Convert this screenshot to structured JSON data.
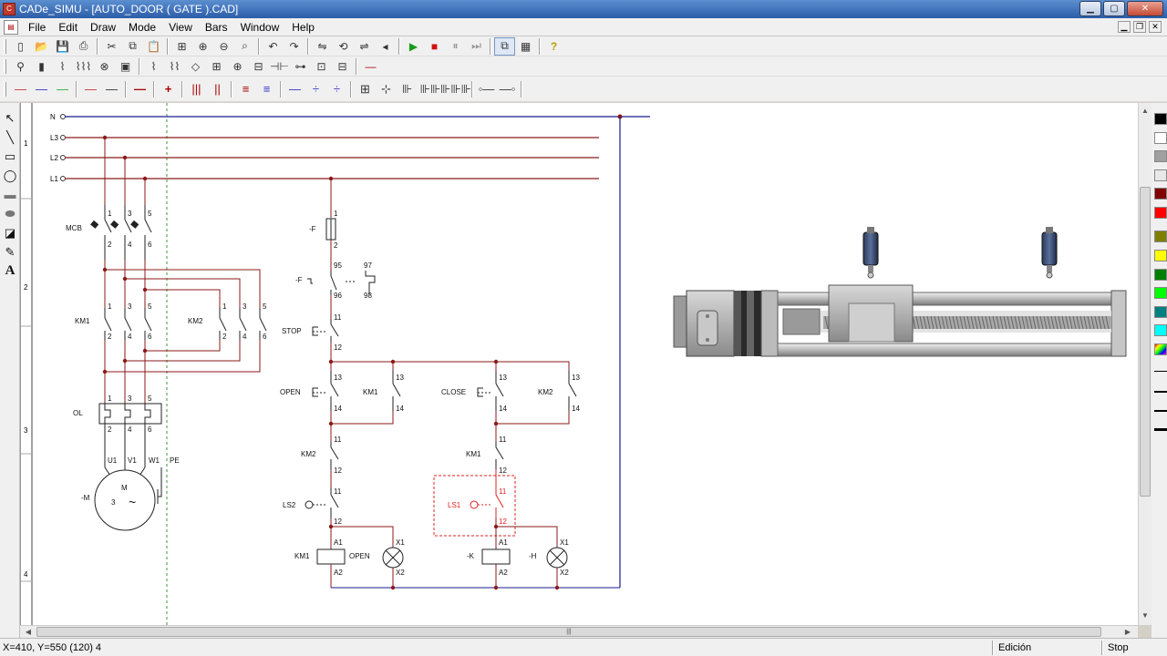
{
  "window": {
    "app_title": "CADe_SIMU - [AUTO_DOOR ( GATE ).CAD]",
    "min_glyph": "▁",
    "max_glyph": "▢",
    "close_glyph": "✕"
  },
  "menu": {
    "items": [
      "File",
      "Edit",
      "Draw",
      "Mode",
      "View",
      "Bars",
      "Window",
      "Help"
    ],
    "mdi_min": "▁",
    "mdi_restore": "❐",
    "mdi_close": "✕"
  },
  "toolbar1": {
    "new_icon": "▯",
    "open_icon": "📂",
    "save_icon": "💾",
    "print_icon": "⎙",
    "cut_icon": "✂",
    "copy_icon": "⧉",
    "paste_icon": "📋",
    "zoom_window_icon": "⊞",
    "zoom_in_icon": "⊕",
    "zoom_out_icon": "⊖",
    "zoom_all_icon": "⌕",
    "undo_icon": "↶",
    "redo_icon": "↷",
    "mirror_h_icon": "⇋",
    "rotate_icon": "⟲",
    "mirror_v_icon": "⇌",
    "back_icon": "◂",
    "play_icon": "▶",
    "stop_icon": "■",
    "pause_icon": "⏸",
    "step_icon": "⏭",
    "window_icon": "⧉",
    "grid_icon": "▦",
    "help_icon": "?"
  },
  "toolbar2": {
    "icons": [
      "⚲",
      "▮",
      "⌇",
      "⌇⌇⌇",
      "⊗",
      "▣",
      "⌇",
      "⌇⌇",
      "◇",
      "⊞",
      "⊕",
      "⊟",
      "⊣⊢",
      "⊶",
      "⊡",
      "⊟",
      "—"
    ]
  },
  "toolbar3": {
    "icons": [
      "—",
      "—",
      "—",
      "—",
      "—",
      "—",
      "+",
      "|||",
      "||",
      "≡",
      "≡",
      "—",
      "÷",
      "÷",
      "⊞",
      "⊹",
      "⊪",
      "⊪⊪",
      "⊪⊪⊪",
      "◦—",
      "—◦"
    ]
  },
  "left_tools": {
    "select_icon": "↖",
    "line_icon": "╲",
    "rect_icon": "▭",
    "circle_icon": "◯",
    "filled_rect_icon": "▬",
    "filled_ellipse_icon": "⬬",
    "fill_icon": "◪",
    "pen_icon": "✎",
    "text_icon": "A"
  },
  "colors": {
    "wire": "#8b1a1a",
    "neutral_wire": "#1a1a8f",
    "sim_active": "#e02020",
    "palette": [
      "#000000",
      "#ffffff",
      "#a0a0a0",
      "#e8e8e8",
      "#800000",
      "#ff0000",
      "#808000",
      "#ffff00",
      "#008000",
      "#00ff00",
      "#008080",
      "#00ffff"
    ]
  },
  "schematic": {
    "ruler_rows": [
      "1",
      "2",
      "3",
      "4"
    ],
    "bus_labels": [
      "N",
      "L3",
      "L2",
      "L1"
    ],
    "power": {
      "mcb_label": "MCB",
      "mcb_top": [
        "1",
        "3",
        "5"
      ],
      "mcb_bottom": [
        "2",
        "4",
        "6"
      ],
      "km1_label": "KM1",
      "km2_label": "KM2",
      "km_top": [
        "1",
        "3",
        "5"
      ],
      "km_bottom": [
        "2",
        "4",
        "6"
      ],
      "ol_label": "OL",
      "ol_top": [
        "1",
        "3",
        "5"
      ],
      "ol_bottom": [
        "2",
        "4",
        "6"
      ],
      "motor_terminals": [
        "U1",
        "V1",
        "W1",
        "PE"
      ],
      "motor_label": "-M",
      "motor_letter": "M",
      "motor_phase": "3",
      "motor_ac": "~"
    },
    "control": {
      "fuse_label": "-F",
      "fuse_top": "1",
      "fuse_bottom": "2",
      "ol_contact_label": "-F",
      "ol_no_top": "95",
      "ol_no_bottom": "96",
      "ol_nc_top": "97",
      "ol_nc_bottom": "98",
      "stop_label": "STOP",
      "stop_top": "11",
      "stop_bottom": "12",
      "open_label": "OPEN",
      "close_label": "CLOSE",
      "km1_label": "KM1",
      "km2_label": "KM2",
      "no_top": "13",
      "no_bottom": "14",
      "nc_top": "11",
      "nc_bottom": "12",
      "ls2_label": "LS2",
      "ls1_label": "LS1",
      "coil_top": "A1",
      "coil_bottom": "A2",
      "coil1_label": "KM1",
      "coil2_label": "-K",
      "lamp_top": "X1",
      "lamp_bottom": "X2",
      "lamp1_label": "OPEN",
      "lamp2_label": "-H"
    },
    "actuator": {
      "left_switch": "limit-switch-left",
      "right_switch": "limit-switch-right"
    }
  },
  "status": {
    "coords": "X=410, Y=550 (120) 4",
    "mode": "Edición",
    "sim": "Stop"
  }
}
